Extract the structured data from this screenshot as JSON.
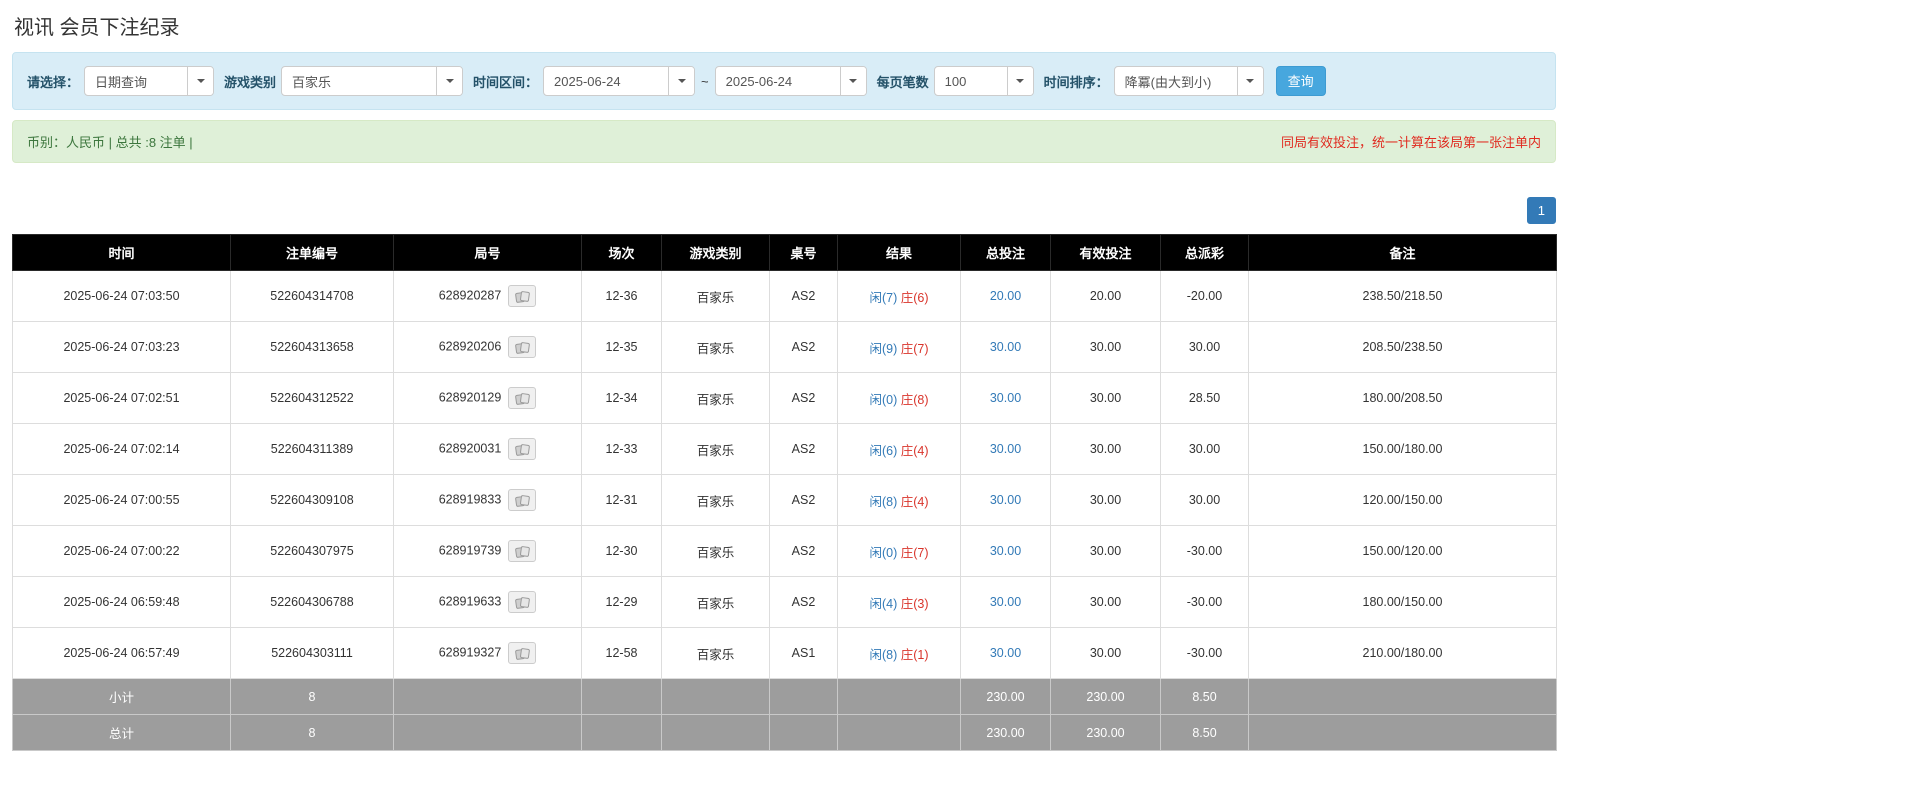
{
  "page": {
    "title": "视讯 会员下注纪录"
  },
  "colors": {
    "accent_blue": "#337ab7",
    "button_blue": "#47a7de",
    "filter_bg": "#d9edf7",
    "summary_bg": "#dff0d8",
    "summary_text": "#3c763d",
    "warning_red": "#e02b20",
    "header_bg": "#000000",
    "footer_bg": "#9d9d9d",
    "player_blue": "#337ab7",
    "banker_red": "#d9342b"
  },
  "filters": {
    "select_label": "请选择：",
    "select_value": "日期查询",
    "game_label": "游戏类别",
    "game_value": "百家乐",
    "range_label": "时间区间：",
    "date_from": "2025-06-24",
    "tilde": "~",
    "date_to": "2025-06-24",
    "per_page_label": "每页笔数",
    "per_page_value": "100",
    "sort_label": "时间排序：",
    "sort_value": "降冪(由大到小)",
    "search_button": "查询"
  },
  "summary": {
    "left": "币别：人民币 | 总共 :8 注单 |",
    "right": "同局有效投注，统一计算在该局第一张注单内"
  },
  "pagination": {
    "current": "1"
  },
  "table": {
    "headers": [
      "时间",
      "注单编号",
      "局号",
      "场次",
      "游戏类别",
      "桌号",
      "结果",
      "总投注",
      "有效投注",
      "总派彩",
      "备注"
    ],
    "rows": [
      {
        "time": "2025-06-24 07:03:50",
        "bet_id": "522604314708",
        "round_id": "628920287",
        "session": "12-36",
        "game": "百家乐",
        "table_no": "AS2",
        "result_player": "闲(7)",
        "result_banker": "庄(6)",
        "total_bet": "20.00",
        "valid_bet": "20.00",
        "payout": "-20.00",
        "remark": "238.50/218.50"
      },
      {
        "time": "2025-06-24 07:03:23",
        "bet_id": "522604313658",
        "round_id": "628920206",
        "session": "12-35",
        "game": "百家乐",
        "table_no": "AS2",
        "result_player": "闲(9)",
        "result_banker": "庄(7)",
        "total_bet": "30.00",
        "valid_bet": "30.00",
        "payout": "30.00",
        "remark": "208.50/238.50"
      },
      {
        "time": "2025-06-24 07:02:51",
        "bet_id": "522604312522",
        "round_id": "628920129",
        "session": "12-34",
        "game": "百家乐",
        "table_no": "AS2",
        "result_player": "闲(0)",
        "result_banker": "庄(8)",
        "total_bet": "30.00",
        "valid_bet": "30.00",
        "payout": "28.50",
        "remark": "180.00/208.50"
      },
      {
        "time": "2025-06-24 07:02:14",
        "bet_id": "522604311389",
        "round_id": "628920031",
        "session": "12-33",
        "game": "百家乐",
        "table_no": "AS2",
        "result_player": "闲(6)",
        "result_banker": "庄(4)",
        "total_bet": "30.00",
        "valid_bet": "30.00",
        "payout": "30.00",
        "remark": "150.00/180.00"
      },
      {
        "time": "2025-06-24 07:00:55",
        "bet_id": "522604309108",
        "round_id": "628919833",
        "session": "12-31",
        "game": "百家乐",
        "table_no": "AS2",
        "result_player": "闲(8)",
        "result_banker": "庄(4)",
        "total_bet": "30.00",
        "valid_bet": "30.00",
        "payout": "30.00",
        "remark": "120.00/150.00"
      },
      {
        "time": "2025-06-24 07:00:22",
        "bet_id": "522604307975",
        "round_id": "628919739",
        "session": "12-30",
        "game": "百家乐",
        "table_no": "AS2",
        "result_player": "闲(0)",
        "result_banker": "庄(7)",
        "total_bet": "30.00",
        "valid_bet": "30.00",
        "payout": "-30.00",
        "remark": "150.00/120.00"
      },
      {
        "time": "2025-06-24 06:59:48",
        "bet_id": "522604306788",
        "round_id": "628919633",
        "session": "12-29",
        "game": "百家乐",
        "table_no": "AS2",
        "result_player": "闲(4)",
        "result_banker": "庄(3)",
        "total_bet": "30.00",
        "valid_bet": "30.00",
        "payout": "-30.00",
        "remark": "180.00/150.00"
      },
      {
        "time": "2025-06-24 06:57:49",
        "bet_id": "522604303111",
        "round_id": "628919327",
        "session": "12-58",
        "game": "百家乐",
        "table_no": "AS1",
        "result_player": "闲(8)",
        "result_banker": "庄(1)",
        "total_bet": "30.00",
        "valid_bet": "30.00",
        "payout": "-30.00",
        "remark": "210.00/180.00"
      }
    ],
    "subtotal": {
      "label": "小计",
      "count": "8",
      "total_bet": "230.00",
      "valid_bet": "230.00",
      "payout": "8.50"
    },
    "total": {
      "label": "总计",
      "count": "8",
      "total_bet": "230.00",
      "valid_bet": "230.00",
      "payout": "8.50"
    }
  }
}
